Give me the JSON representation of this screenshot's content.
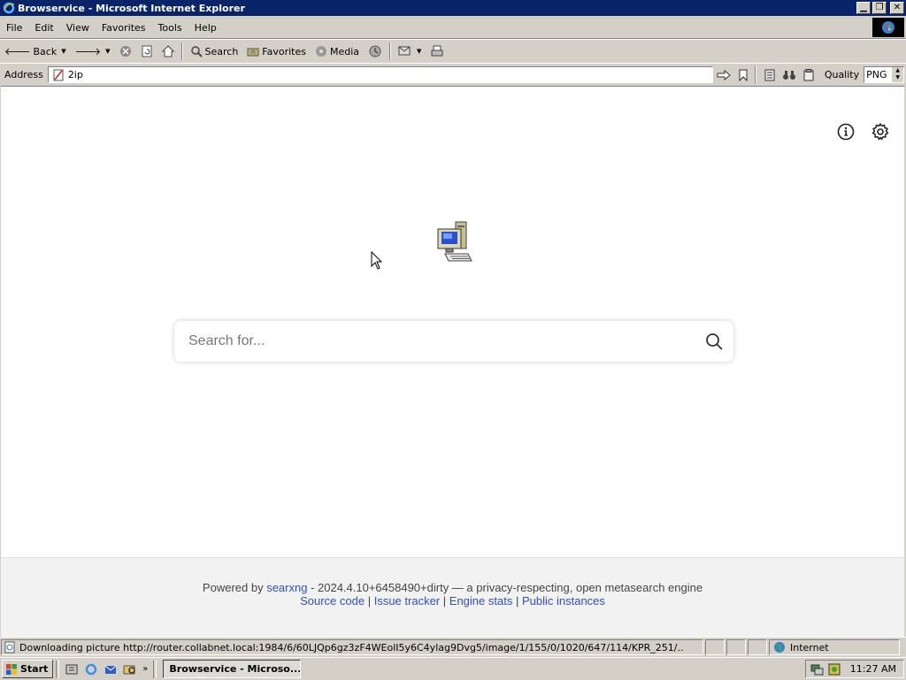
{
  "window": {
    "title": "Browservice - Microsoft Internet Explorer",
    "minimize_icon": "minimize-icon",
    "restore_icon": "restore-icon",
    "close_icon": "close-icon"
  },
  "menu": [
    "File",
    "Edit",
    "View",
    "Favorites",
    "Tools",
    "Help"
  ],
  "toolbar": {
    "back_label": "Back",
    "search_label": "Search",
    "favorites_label": "Favorites",
    "media_label": "Media"
  },
  "address": {
    "label": "Address",
    "value": "2ip",
    "quality_label": "Quality",
    "quality_value": "PNG"
  },
  "page": {
    "search_placeholder": "Search for...",
    "footer_powered": "Powered by",
    "footer_link": "searxng",
    "footer_version": " - 2024.4.10+6458490+dirty — a privacy-respecting, open metasearch engine",
    "source_code": "Source code",
    "issue_tracker": "Issue tracker",
    "engine_stats": "Engine stats",
    "public_instances": "Public instances",
    "separator": "|"
  },
  "status": {
    "text": "Downloading picture http://router.collabnet.local:1984/6/60LJQp6gz3zF4WEolI5y6C4ylag9Dvg5/image/1/155/0/1020/647/114/KPR_251/..",
    "zone": "Internet"
  },
  "taskbar": {
    "start_label": "Start",
    "task_label": "Browservice - Microso...",
    "clock": "11:27 AM"
  },
  "colors": {
    "titlebar": "#0a246a",
    "chrome": "#d4d0c8",
    "link": "#3050c0"
  }
}
